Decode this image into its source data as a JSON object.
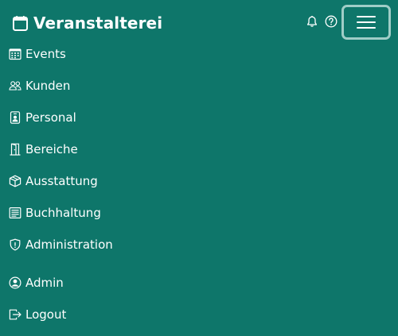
{
  "app": {
    "brand": "Veranstalterei",
    "brand_icon": "calendar-icon"
  },
  "topbar": {
    "notifications_icon": "bell-icon",
    "help_icon": "question-circle-icon",
    "menu_toggle_icon": "hamburger-menu-icon"
  },
  "menu": {
    "items": [
      {
        "label": "Events",
        "icon": "calendar-grid-icon"
      },
      {
        "label": "Kunden",
        "icon": "people-icon"
      },
      {
        "label": "Personal",
        "icon": "person-badge-icon"
      },
      {
        "label": "Bereiche",
        "icon": "door-icon"
      },
      {
        "label": "Ausstattung",
        "icon": "box-icon"
      },
      {
        "label": "Buchhaltung",
        "icon": "ledger-icon"
      },
      {
        "label": "Administration",
        "icon": "shield-icon"
      }
    ],
    "account": [
      {
        "label": "Admin",
        "icon": "person-circle-icon"
      },
      {
        "label": "Logout",
        "icon": "logout-icon"
      }
    ]
  },
  "colors": {
    "background": "#0e766a",
    "text": "#ffffff",
    "toggle_border": "#9fcdc7"
  }
}
